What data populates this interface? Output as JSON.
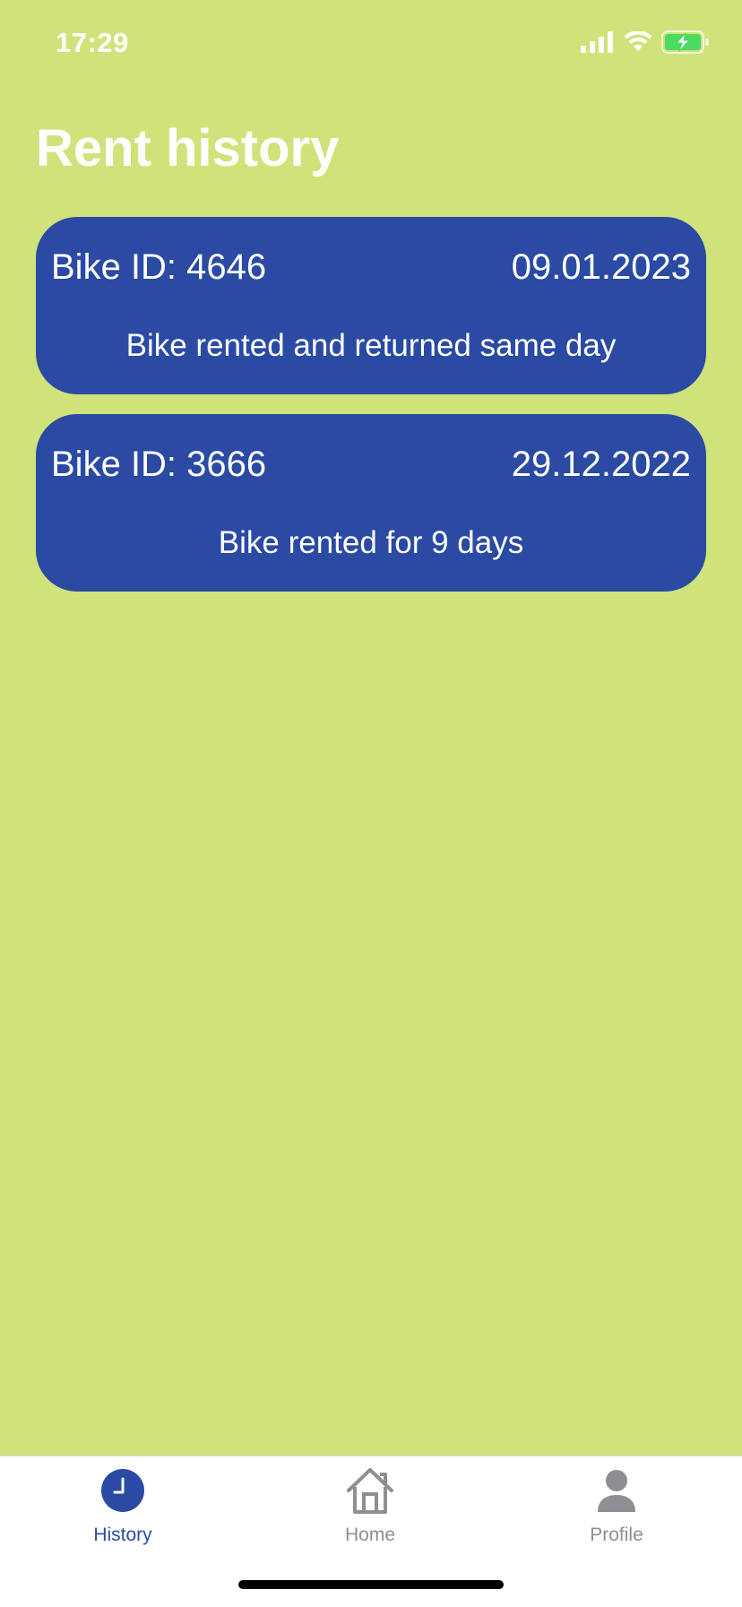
{
  "status_bar": {
    "time": "17:29",
    "signal_icon": "cellular-signal-icon",
    "wifi_icon": "wifi-icon",
    "battery_icon": "battery-charging-icon"
  },
  "page": {
    "title": "Rent history",
    "background_color": "#d0e37a",
    "card_color": "#2a4aa4"
  },
  "rentals": [
    {
      "bike_id": "Bike ID: 4646",
      "date": "09.01.2023",
      "description": "Bike rented and returned same day"
    },
    {
      "bike_id": "Bike ID: 3666",
      "date": "29.12.2022",
      "description": "Bike rented for 9 days"
    }
  ],
  "tab_bar": {
    "tabs": [
      {
        "label": "History",
        "icon": "clock-icon",
        "active": true
      },
      {
        "label": "Home",
        "icon": "house-icon",
        "active": false
      },
      {
        "label": "Profile",
        "icon": "person-icon",
        "active": false
      }
    ],
    "active_color": "#2a4aa4",
    "inactive_color": "#8e8e93"
  }
}
